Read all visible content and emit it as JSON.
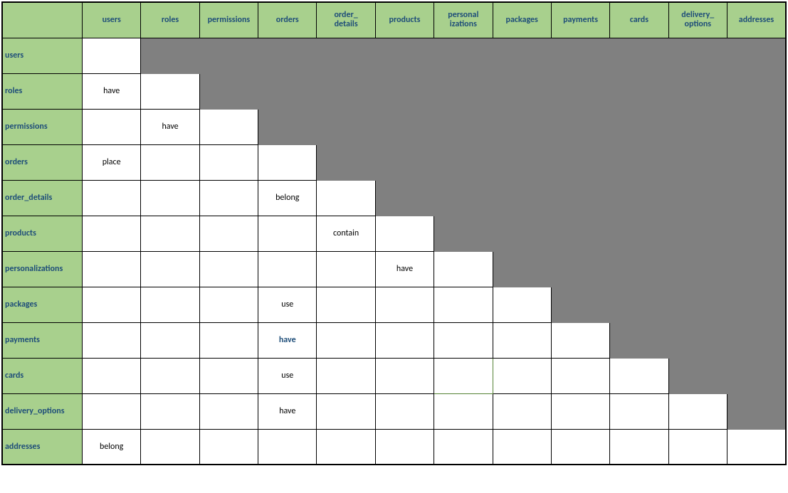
{
  "columns": [
    "users",
    "roles",
    "permissions",
    "orders",
    "order_\ndetails",
    "products",
    "personal\nizations",
    "packages",
    "payments",
    "cards",
    "delivery_\noptions",
    "addresses"
  ],
  "rows": [
    "users",
    "roles",
    "permissions",
    "orders",
    "order_details",
    "products",
    "personalizations",
    "packages",
    "payments",
    "cards",
    "delivery_options",
    "addresses"
  ],
  "cells": {
    "roles|users": {
      "text": "have"
    },
    "permissions|roles": {
      "text": "have"
    },
    "orders|users": {
      "text": "place"
    },
    "order_details|orders": {
      "text": "belong"
    },
    "products|order_details": {
      "text": "contain"
    },
    "personalizations|products": {
      "text": "have"
    },
    "packages|orders": {
      "text": "use"
    },
    "payments|orders": {
      "text": "have",
      "bold": true
    },
    "cards|orders": {
      "text": "use"
    },
    "delivery_options|orders": {
      "text": "have"
    },
    "addresses|users": {
      "text": "belong"
    }
  },
  "green_border_cell": "cards|personalizations"
}
